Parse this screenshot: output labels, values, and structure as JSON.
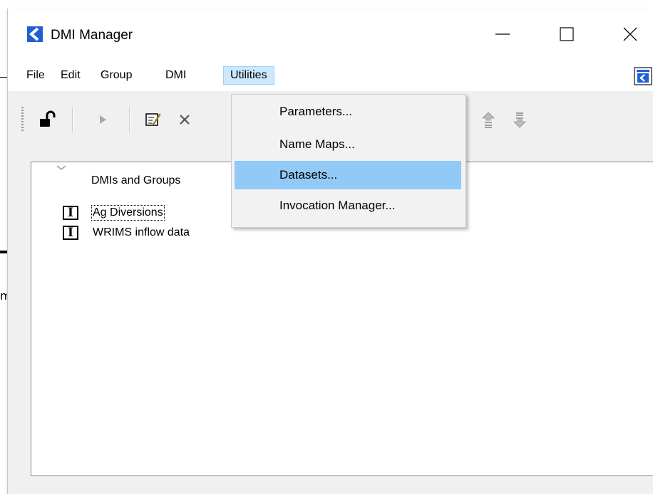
{
  "window": {
    "title": "DMI Manager"
  },
  "menubar": {
    "items": [
      {
        "label": "File"
      },
      {
        "label": "Edit"
      },
      {
        "label": "Group"
      },
      {
        "label": "DMI"
      },
      {
        "label": "Utilities",
        "active": true
      }
    ]
  },
  "toolbar": {
    "buttons": [
      "unlock-icon",
      "run-icon",
      "edit-icon",
      "delete-icon",
      "move-up-icon",
      "move-down-icon"
    ]
  },
  "tree": {
    "header": "DMIs and Groups",
    "rows": [
      {
        "icon": "I",
        "label": "Ag Diversions",
        "selected": true
      },
      {
        "icon": "I",
        "label": "WRIMS inflow data"
      }
    ]
  },
  "utilities_menu": {
    "items": [
      {
        "label": "Parameters..."
      },
      {
        "label": "Name Maps..."
      },
      {
        "label": "Datasets...",
        "highlighted": true
      },
      {
        "label": "Invocation Manager..."
      }
    ]
  },
  "background": {
    "text": "m"
  },
  "colors": {
    "menu_highlight": "#91c9f7",
    "active_menu": "#cce8ff",
    "brand_blue": "#1e5fd6"
  }
}
